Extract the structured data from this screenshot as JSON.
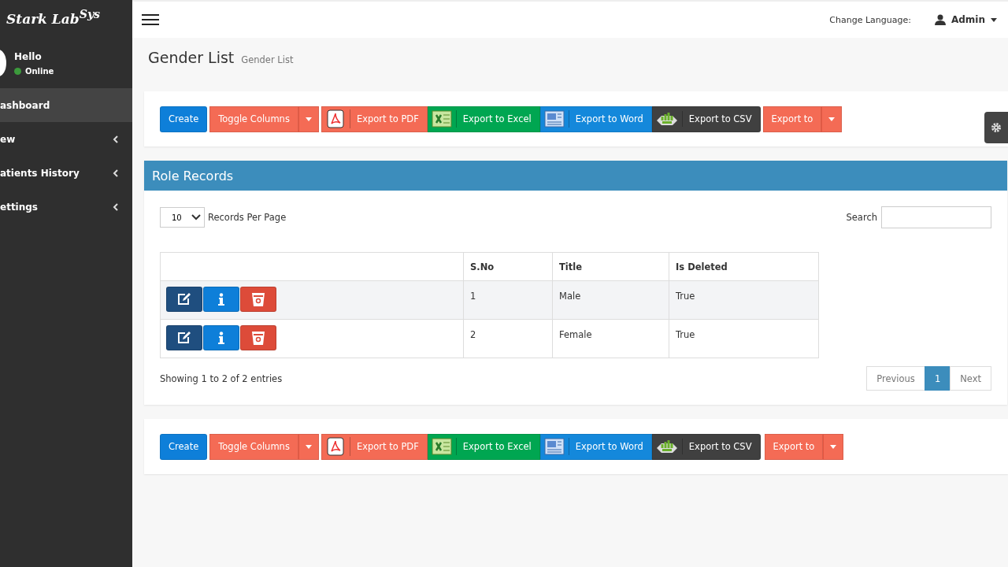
{
  "sidebar": {
    "logo": "Stark Lab$^{Sys}$",
    "user": {
      "greeting": "Hello",
      "status": "Online"
    },
    "items": [
      {
        "label": "ashboard",
        "selected": true,
        "submenu": false
      },
      {
        "label": "ew",
        "selected": false,
        "submenu": true
      },
      {
        "label": "atients History",
        "selected": false,
        "submenu": true
      },
      {
        "label": "ettings",
        "selected": false,
        "submenu": true
      }
    ]
  },
  "header": {
    "language_label": "Change Language:",
    "user": "Admin"
  },
  "page": {
    "title": "Gender List",
    "subtitle": "Gender List"
  },
  "toolbar_top": [
    {
      "kind": "create",
      "label": "Create"
    },
    {
      "kind": "toggle",
      "label": "Toggle Columns"
    },
    {
      "kind": "pdf",
      "label": "Export to PDF"
    },
    {
      "kind": "excel",
      "label": "Export to Excel"
    },
    {
      "kind": "word",
      "label": "Export to Word"
    },
    {
      "kind": "csv",
      "label": "Export to CSV"
    },
    {
      "kind": "export",
      "label": "Export to"
    }
  ],
  "panel": {
    "title": "Role Records",
    "page_size": "10",
    "page_size_label": "Records Per Page",
    "search_label": "Search",
    "table": {
      "columns": [
        "S.No",
        "Title",
        "Is Deleted"
      ],
      "rows": [
        {
          "sno": "1",
          "title": "Male",
          "deleted": "True"
        },
        {
          "sno": "2",
          "title": "Female",
          "deleted": "True"
        }
      ]
    },
    "info": "Showing 1 to 2 of 2 entries",
    "pagination": [
      {
        "label": "Previous",
        "selected": false
      },
      {
        "label": "1",
        "selected": true
      },
      {
        "label": "Next",
        "selected": false
      }
    ]
  },
  "toolbar_bottom": [
    {
      "kind": "create",
      "label": "Create"
    },
    {
      "kind": "toggle",
      "label": "Toggle Columns"
    },
    {
      "kind": "pdf",
      "label": "Export to PDF"
    },
    {
      "kind": "excel",
      "label": "Export to Excel"
    },
    {
      "kind": "word",
      "label": "Export to Word"
    },
    {
      "kind": "csv",
      "label": "Export to CSV"
    },
    {
      "kind": "export",
      "label": "Export to"
    }
  ]
}
